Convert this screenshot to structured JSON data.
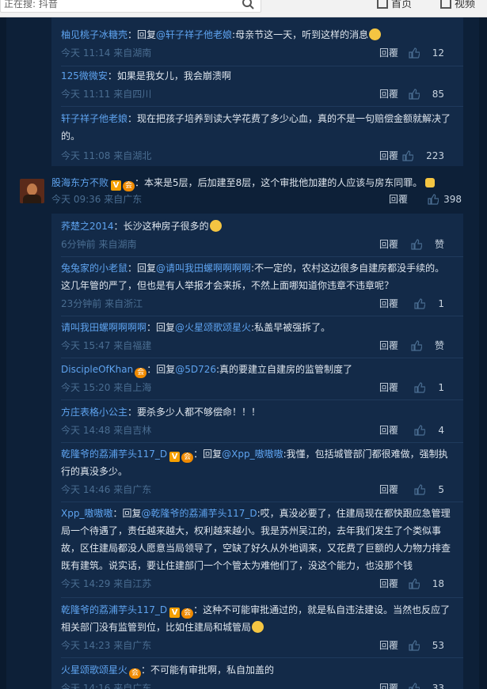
{
  "topbar": {
    "search_text": "正在搜: 抖音",
    "home_label": "首页",
    "video_label": "视频"
  },
  "top_replies": [
    {
      "user": "柚见桃子冰糖壳",
      "sep": "：回复",
      "at": "@轩子祥子他老娘",
      "text": ":母亲节这一天，听到这样的消息",
      "emoji": true,
      "time": "今天 11:14 来自湖南",
      "reply": "回覆",
      "likes": "12"
    },
    {
      "user": "125微微安",
      "sep": "：",
      "at": "",
      "text": "如果是我女儿，我会崩溃啊",
      "emoji": false,
      "time": "今天 11:11 来自四川",
      "reply": "回覆",
      "likes": "85"
    },
    {
      "user": "轩子祥子他老娘",
      "sep": "：",
      "at": "",
      "text": "现在把孩子培养到读大学花费了多少心血，真的不是一句赔偿金额就解决了的。",
      "emoji": false,
      "time": "今天 11:08 来自湖北",
      "reply": "回覆",
      "likes": "223"
    }
  ],
  "main_comment": {
    "user": "股海东方不败",
    "badge_v": "V",
    "badge_crown": "会",
    "text": "：本来是5层，后加建至8层，这个审批他加建的人应该与房东同罪。",
    "time": "今天 09:36 来自广东",
    "reply": "回覆",
    "likes": "398"
  },
  "replies": [
    {
      "user": "荞楚之2014",
      "sep": "：",
      "at": "",
      "text": "长沙这种房子很多的",
      "emoji": true,
      "time": "6分钟前 来自湖南",
      "reply": "回覆",
      "likes": "赞"
    },
    {
      "user": "兔兔家的小老鼠",
      "sep": "：回复",
      "at": "@请叫我田螺啊啊啊啊",
      "text": ":不一定的，农村这边很多自建房都没手续的。这几年管的严了，但也是有人举报才会来拆，不然上面哪知道你违章不违章呢？",
      "emoji": false,
      "time": "23分钟前 来自浙江",
      "reply": "回覆",
      "likes": "1"
    },
    {
      "user": "请叫我田螺啊啊啊啊",
      "sep": "：回复",
      "at": "@火星颂歌颂星火",
      "text": ":私盖早被强拆了。",
      "emoji": false,
      "time": "今天 15:47 来自福建",
      "reply": "回覆",
      "likes": "赞"
    },
    {
      "user": "DiscipleOfKhan",
      "sep": "：回复",
      "at": "@5D726",
      "text": ":真的要建立自建房的监管制度了",
      "emoji": false,
      "crown": true,
      "time": "今天 15:20 来自上海",
      "reply": "回覆",
      "likes": "1"
    },
    {
      "user": "方庄表格小公主",
      "sep": "：",
      "at": "",
      "text": "要杀多少人都不够偿命！！！",
      "emoji": false,
      "time": "今天 14:48 来自吉林",
      "reply": "回覆",
      "likes": "4"
    },
    {
      "user": "乾隆爷的荔浦芋头117_D",
      "sep": "：回复",
      "at": "@Xpp_嗷嗷嗷",
      "text": ":我懂，包括城管部门都很难做，强制执行的真没多少。",
      "emoji": false,
      "vcrown": true,
      "time": "今天 14:46 来自广东",
      "reply": "回覆",
      "likes": "5"
    },
    {
      "user": "Xpp_嗷嗷嗷",
      "sep": "：回复",
      "at": "@乾隆爷的荔浦芋头117_D",
      "text": ":哎，真没必要了，住建局现在都快跟应急管理局一个待遇了，责任越来越大，权利越来越小。我是苏州吴江的，去年我们发生了个类似事故，区住建局都没人愿意当局领导了，空缺了好久从外地调来，又花费了巨额的人力物力排查既有建筑。说实话，要让住建部门一个个管太为难他们了，没这个能力，也没那个钱",
      "emoji": false,
      "time": "今天 14:29 来自江苏",
      "reply": "回覆",
      "likes": "18"
    },
    {
      "user": "乾隆爷的荔浦芋头117_D",
      "sep": "：",
      "at": "",
      "text": "这种不可能审批通过的，就是私自违法建设。当然也反应了相关部门没有监管到位，比如住建局和城管局",
      "emoji": true,
      "vcrown": true,
      "time": "今天 14:23 来自广东",
      "reply": "回覆",
      "likes": "53"
    },
    {
      "user": "火星颂歌颂星火",
      "sep": "：",
      "at": "",
      "text": "不可能有审批啊，私自加盖的",
      "emoji": false,
      "crown": true,
      "time": "今天 14:16 来自广东",
      "reply": "回覆",
      "likes": "33"
    }
  ]
}
